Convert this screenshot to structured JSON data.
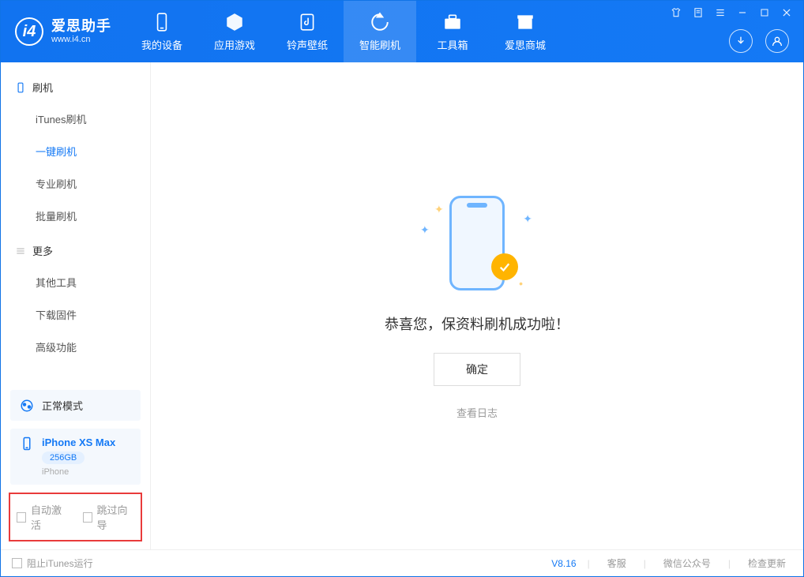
{
  "app": {
    "title": "爱思助手",
    "url": "www.i4.cn"
  },
  "nav": [
    {
      "label": "我的设备",
      "icon": "device"
    },
    {
      "label": "应用游戏",
      "icon": "cube"
    },
    {
      "label": "铃声壁纸",
      "icon": "music"
    },
    {
      "label": "智能刷机",
      "icon": "refresh",
      "active": true
    },
    {
      "label": "工具箱",
      "icon": "toolbox"
    },
    {
      "label": "爱思商城",
      "icon": "store"
    }
  ],
  "sidebar": {
    "section1_title": "刷机",
    "section1_items": [
      "iTunes刷机",
      "一键刷机",
      "专业刷机",
      "批量刷机"
    ],
    "section1_active_index": 1,
    "section2_title": "更多",
    "section2_items": [
      "其他工具",
      "下载固件",
      "高级功能"
    ]
  },
  "mode_card": {
    "label": "正常模式"
  },
  "device_card": {
    "name": "iPhone XS Max",
    "storage": "256GB",
    "sub": "iPhone"
  },
  "bottom_options": {
    "opt1": "自动激活",
    "opt2": "跳过向导"
  },
  "main": {
    "success_text": "恭喜您，保资料刷机成功啦！",
    "confirm_label": "确定",
    "log_link": "查看日志"
  },
  "footer": {
    "block_itunes": "阻止iTunes运行",
    "version": "V8.16",
    "links": [
      "客服",
      "微信公众号",
      "检查更新"
    ]
  }
}
